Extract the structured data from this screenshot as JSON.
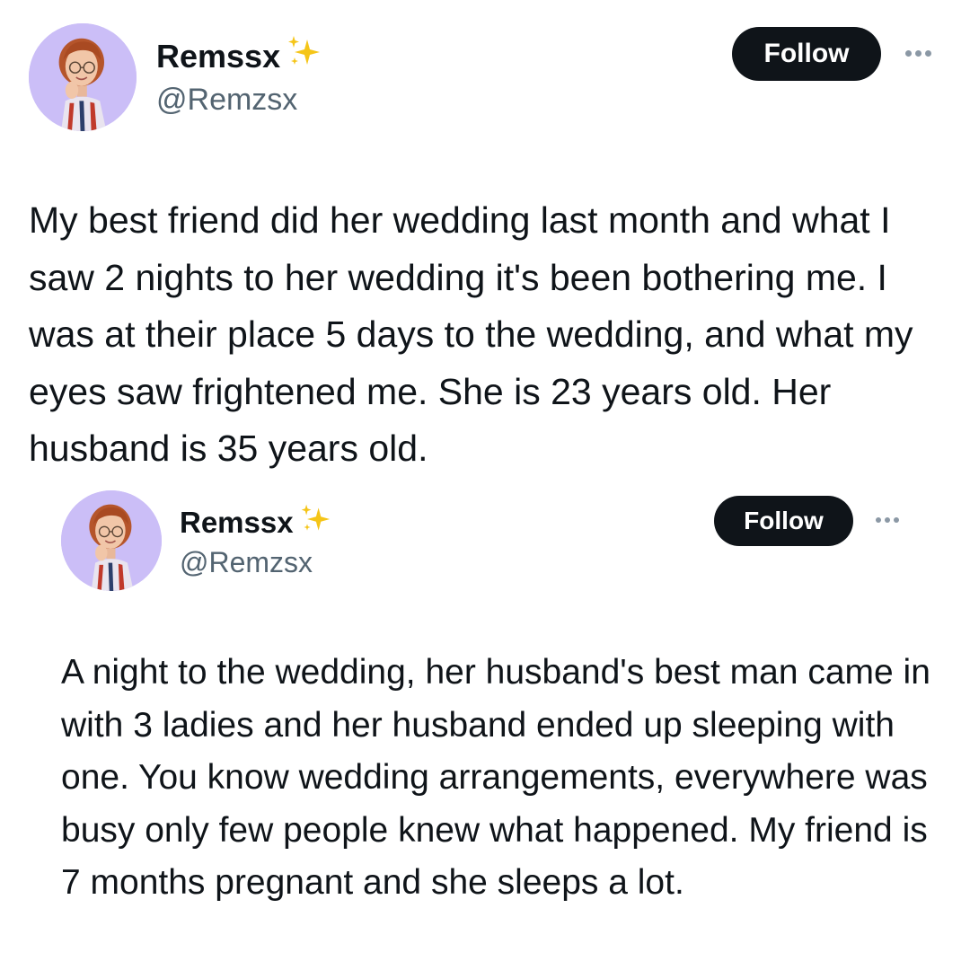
{
  "tweets": [
    {
      "author": {
        "display_name": "Remssx",
        "emoji": "sparkles-emoji",
        "handle": "@Remzsx"
      },
      "follow_label": "Follow",
      "more_icon": "more-horizontal-icon",
      "text": "My best friend did her wedding last month and what I saw 2 nights to her wedding it's been bothering me. I was at their place 5 days to the wedding, and what my eyes saw frightened me. She is 23 years old. Her husband is 35 years old."
    },
    {
      "author": {
        "display_name": "Remssx",
        "emoji": "sparkles-emoji",
        "handle": "@Remzsx"
      },
      "follow_label": "Follow",
      "more_icon": "more-horizontal-icon",
      "text": "A night to the wedding, her husband's best man came in with 3 ladies and her husband ended up sleeping with one. You know wedding arrangements, everywhere was busy only few people knew what happened. My friend is 7 months pregnant and she sleeps a lot."
    }
  ],
  "colors": {
    "avatar_bg": "#cbbef7",
    "follow_bg": "#0f1419",
    "text": "#0f1419",
    "handle": "#536471",
    "sparkle": "#f5c518"
  }
}
